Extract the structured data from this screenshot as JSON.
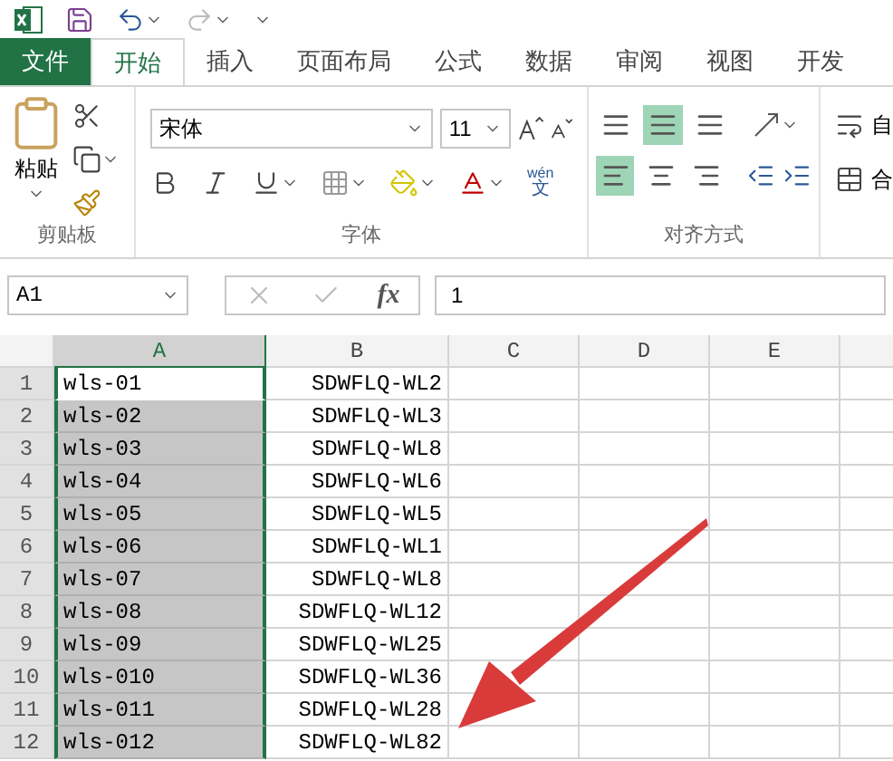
{
  "ribbon_tabs": [
    {
      "label": "文件",
      "kind": "file",
      "selected": false
    },
    {
      "label": "开始",
      "kind": "tab",
      "selected": true
    },
    {
      "label": "插入",
      "kind": "tab",
      "selected": false
    },
    {
      "label": "页面布局",
      "kind": "tab",
      "selected": false
    },
    {
      "label": "公式",
      "kind": "tab",
      "selected": false
    },
    {
      "label": "数据",
      "kind": "tab",
      "selected": false
    },
    {
      "label": "审阅",
      "kind": "tab",
      "selected": false
    },
    {
      "label": "视图",
      "kind": "tab",
      "selected": false
    },
    {
      "label": "开发",
      "kind": "tab",
      "selected": false
    }
  ],
  "clipboard": {
    "paste_label": "粘贴",
    "group_label": "剪贴板"
  },
  "font": {
    "name": "宋体",
    "size": "11",
    "phonetic_top": "wén",
    "phonetic_bottom": "文",
    "group_label": "字体"
  },
  "alignment": {
    "vertical": [
      {
        "selected": false
      },
      {
        "selected": true
      },
      {
        "selected": false
      }
    ],
    "horizontal": [
      {
        "selected": true
      },
      {
        "selected": false
      },
      {
        "selected": false
      }
    ],
    "group_label": "对齐方式"
  },
  "cut_group": {
    "top": "自",
    "bottom": "合"
  },
  "formula_bar": {
    "name_box": "A1",
    "fx": "fx",
    "value": "1"
  },
  "columns": [
    {
      "label": "A",
      "selected": true
    },
    {
      "label": "B",
      "selected": false
    },
    {
      "label": "C",
      "selected": false
    },
    {
      "label": "D",
      "selected": false
    },
    {
      "label": "E",
      "selected": false
    }
  ],
  "rows": [
    {
      "number": "1",
      "a": "wls-01",
      "b": "SDWFLQ-WL2",
      "active": true
    },
    {
      "number": "2",
      "a": "wls-02",
      "b": "SDWFLQ-WL3",
      "active": false
    },
    {
      "number": "3",
      "a": "wls-03",
      "b": "SDWFLQ-WL8",
      "active": false
    },
    {
      "number": "4",
      "a": "wls-04",
      "b": "SDWFLQ-WL6",
      "active": false
    },
    {
      "number": "5",
      "a": "wls-05",
      "b": "SDWFLQ-WL5",
      "active": false
    },
    {
      "number": "6",
      "a": "wls-06",
      "b": "SDWFLQ-WL1",
      "active": false
    },
    {
      "number": "7",
      "a": "wls-07",
      "b": "SDWFLQ-WL8",
      "active": false
    },
    {
      "number": "8",
      "a": "wls-08",
      "b": "SDWFLQ-WL12",
      "active": false
    },
    {
      "number": "9",
      "a": "wls-09",
      "b": "SDWFLQ-WL25",
      "active": false
    },
    {
      "number": "10",
      "a": "wls-010",
      "b": "SDWFLQ-WL36",
      "active": false
    },
    {
      "number": "11",
      "a": "wls-011",
      "b": "SDWFLQ-WL28",
      "active": false
    },
    {
      "number": "12",
      "a": "wls-012",
      "b": "SDWFLQ-WL82",
      "active": false
    }
  ]
}
